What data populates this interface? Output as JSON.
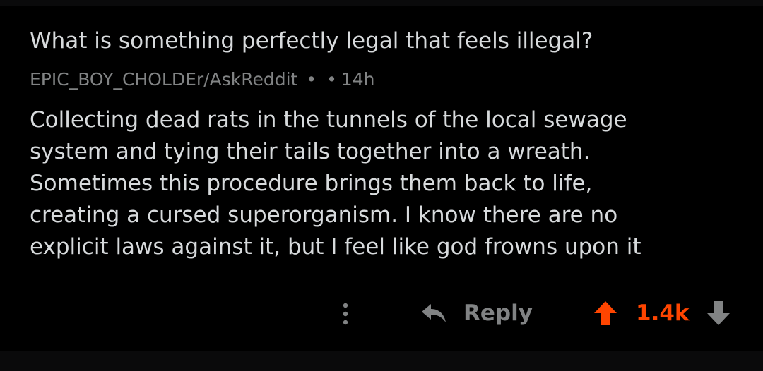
{
  "post": {
    "title": "What is something perfectly legal that feels illegal?",
    "author_subreddit": "EPIC_BOY_CHOLDEr/AskReddit",
    "separator_1": "•",
    "separator_2": "•",
    "time_ago": "14h"
  },
  "comment": {
    "lines": [
      "Collecting dead rats in the tunnels of the local sewage",
      "system and tying their tails together into a wreath.",
      "Sometimes this procedure brings them back to life,",
      "creating a cursed superorganism. I know there are no",
      "explicit laws against it, but I feel like god frowns upon it"
    ]
  },
  "actions": {
    "more_icon": "more-vertical-icon",
    "reply_icon": "reply-arrow-icon",
    "reply_label": "Reply",
    "upvote_icon": "upvote-arrow-icon",
    "score": "1.4k",
    "downvote_icon": "downvote-arrow-icon"
  },
  "colors": {
    "background": "#000000",
    "text_primary": "#d7dadc",
    "text_muted": "#818384",
    "upvote_accent": "#ff4500"
  }
}
